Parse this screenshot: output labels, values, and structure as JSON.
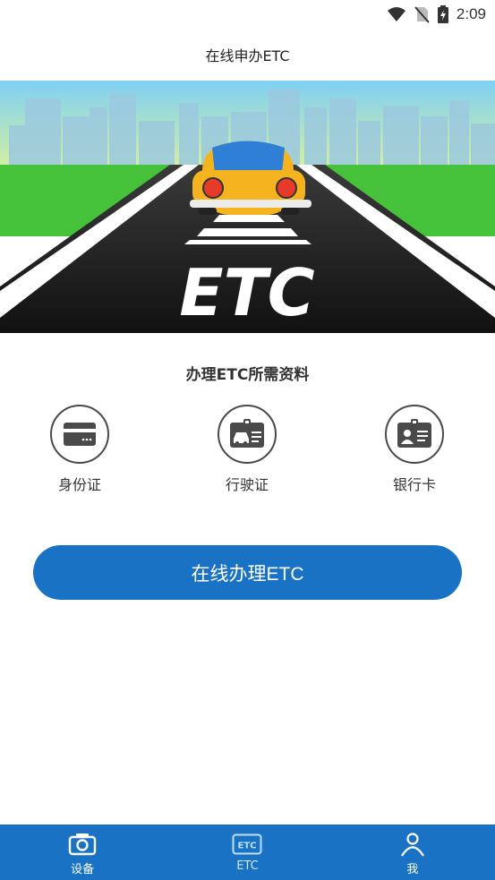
{
  "status_bar": {
    "time": "2:09"
  },
  "header": {
    "title": "在线申办ETC"
  },
  "banner": {
    "road_marking": "ETC"
  },
  "requirements": {
    "title": "办理ETC所需资料",
    "items": [
      {
        "label": "身份证",
        "icon": "card-icon"
      },
      {
        "label": "行驶证",
        "icon": "vehicle-license-icon"
      },
      {
        "label": "银行卡",
        "icon": "id-badge-icon"
      }
    ]
  },
  "apply_button": {
    "label": "在线办理ETC"
  },
  "tab_bar": {
    "tabs": [
      {
        "label": "设备",
        "icon": "camera-icon"
      },
      {
        "label": "ETC",
        "icon": "etc-icon"
      },
      {
        "label": "我",
        "icon": "person-icon"
      }
    ],
    "active": "ETC"
  },
  "colors": {
    "primary": "#1a72c4",
    "icon_dark": "#4a4a4a",
    "road": "#1e1e1e",
    "grass": "#45c23a",
    "car": "#f5b41f"
  }
}
